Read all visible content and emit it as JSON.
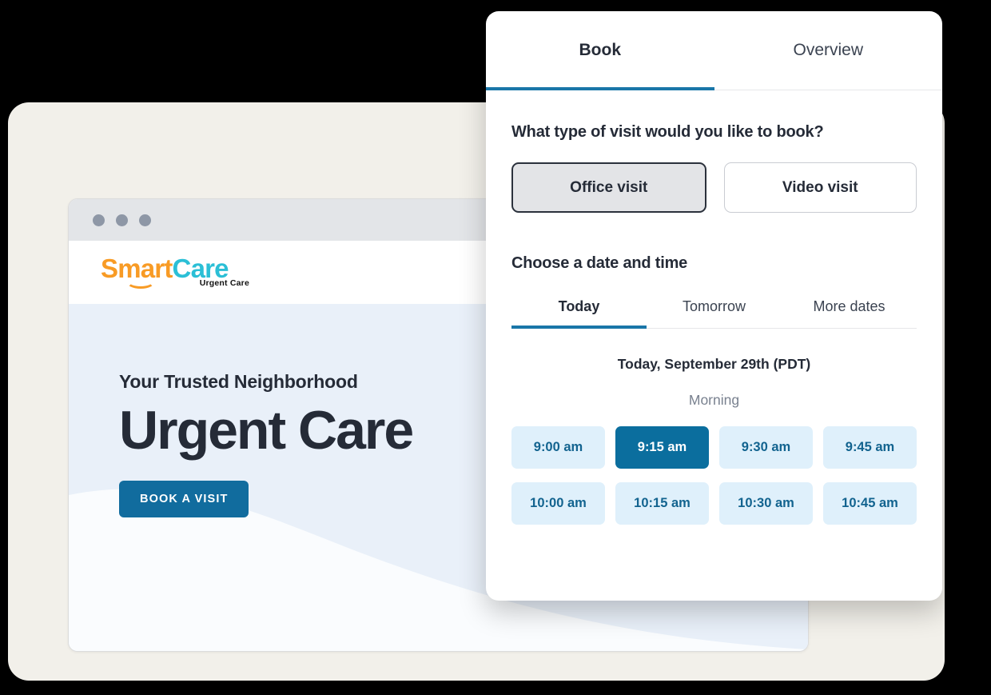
{
  "backdrop": {
    "name": "beige-backdrop"
  },
  "browser": {
    "window_dots": [
      "dot-1",
      "dot-2",
      "dot-3"
    ],
    "logo": {
      "part_one": "Smart",
      "part_two": "Care",
      "tagline": "Urgent Care",
      "color_smart": "#F89B25",
      "color_care": "#2BBFD6"
    },
    "hero": {
      "eyebrow": "Your Trusted Neighborhood",
      "title": "Urgent Care",
      "cta_label": "BOOK A VISIT",
      "cta_color": "#116C9E",
      "background_color": "#E9F0F9"
    }
  },
  "booking_card": {
    "tabs": [
      {
        "label": "Book",
        "active": true
      },
      {
        "label": "Overview",
        "active": false
      }
    ],
    "visit_type": {
      "question": "What type of visit would you like to book?",
      "options": [
        {
          "label": "Office visit",
          "selected": true
        },
        {
          "label": "Video visit",
          "selected": false
        }
      ]
    },
    "date_time": {
      "heading": "Choose a date and time",
      "date_tabs": [
        {
          "label": "Today",
          "active": true
        },
        {
          "label": "Tomorrow",
          "active": false
        },
        {
          "label": "More dates",
          "active": false
        }
      ],
      "selected_date_label": "Today, September 29th (PDT)",
      "period_label": "Morning",
      "slots": [
        {
          "label": "9:00 am",
          "selected": false
        },
        {
          "label": "9:15 am",
          "selected": true
        },
        {
          "label": "9:30 am",
          "selected": false
        },
        {
          "label": "9:45 am",
          "selected": false
        },
        {
          "label": "10:00 am",
          "selected": false
        },
        {
          "label": "10:15 am",
          "selected": false
        },
        {
          "label": "10:30 am",
          "selected": false
        },
        {
          "label": "10:45 am",
          "selected": false
        }
      ],
      "accent_color": "#1976A8",
      "slot_bg": "#DFF0FB",
      "slot_text": "#12638F",
      "slot_selected_bg": "#0B6E9E"
    }
  }
}
